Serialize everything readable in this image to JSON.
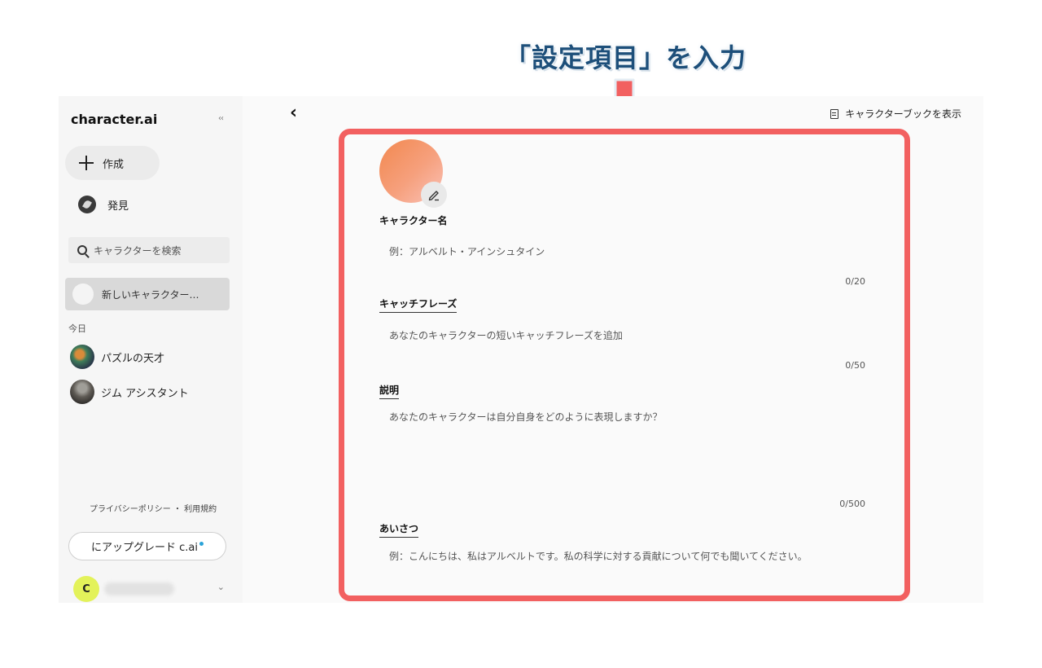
{
  "annotation": {
    "callout_text": "「設定項目」を入力",
    "box_color": "#f26060"
  },
  "sidebar": {
    "logo": "character.ai",
    "collapse_label": "‹‹",
    "create_label": "作成",
    "discover_label": "発見",
    "search_placeholder": "キャラクターを検索",
    "new_character_label": "新しいキャラクター…",
    "section_today": "今日",
    "chats": [
      {
        "name": "パズルの天才"
      },
      {
        "name": "ジム アシスタント"
      }
    ],
    "footer_links": "プライバシーポリシー ・ 利用規約",
    "upgrade_label": "にアップグレード c.ai",
    "user_initial": "C"
  },
  "main": {
    "back_label": "‹",
    "character_book_label": "キャラクターブックを表示",
    "fields": {
      "name": {
        "label": "キャラクター名",
        "placeholder": "例：アルベルト・アインシュタイン",
        "count": "0/20"
      },
      "tagline": {
        "label": "キャッチフレーズ",
        "placeholder": "あなたのキャラクターの短いキャッチフレーズを追加",
        "count": "0/50"
      },
      "description": {
        "label": "説明",
        "placeholder": "あなたのキャラクターは自分自身をどのように表現しますか？",
        "count": "0/500"
      },
      "greeting": {
        "label": "あいさつ",
        "placeholder": "例：こんにちは、私はアルベルトです。私の科学に対する貢献について何でも聞いてください。"
      }
    }
  },
  "colors": {
    "accent_red": "#f26060",
    "callout_blue": "#1d4f7a",
    "avatar_orange": "#f2884f",
    "user_avatar": "#e3f25a"
  }
}
